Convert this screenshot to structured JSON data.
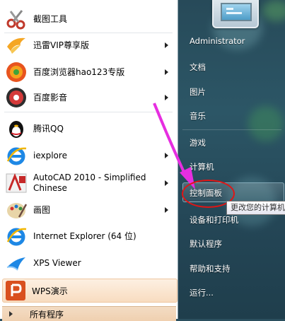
{
  "programs": [
    {
      "label": "截图工具",
      "icon": "scissors-icon",
      "has_submenu": false
    },
    {
      "label": "迅雷VIP尊享版",
      "icon": "thunder-bird-icon",
      "has_submenu": true
    },
    {
      "label": "百度浏览器hao123专版",
      "icon": "baidu-browser-icon",
      "has_submenu": true
    },
    {
      "label": "百度影音",
      "icon": "baidu-player-icon",
      "has_submenu": true
    },
    {
      "label": "腾讯QQ",
      "icon": "qq-penguin-icon",
      "has_submenu": false
    },
    {
      "label": "iexplore",
      "icon": "ie-icon",
      "has_submenu": true
    },
    {
      "label": "AutoCAD 2010 - Simplified Chinese",
      "label_line1": "AutoCAD 2010 - Simplified",
      "label_line2": "Chinese",
      "icon": "autocad-icon",
      "has_submenu": true
    },
    {
      "label": "画图",
      "icon": "paint-palette-icon",
      "has_submenu": true
    },
    {
      "label": "Internet Explorer (64 位)",
      "icon": "ie-icon",
      "has_submenu": false
    },
    {
      "label": "XPS Viewer",
      "icon": "xps-viewer-icon",
      "has_submenu": false
    }
  ],
  "pinned_highlight": {
    "label": "WPS演示",
    "icon": "wps-presentation-icon"
  },
  "all_programs": {
    "label": "所有程序"
  },
  "right": {
    "user": "Administrator",
    "documents": "文档",
    "pictures": "图片",
    "music": "音乐",
    "games": "游戏",
    "computer": "计算机",
    "control_panel": "控制面板",
    "devices": "设备和打印机",
    "default_programs": "默认程序",
    "help": "帮助和支持",
    "run": "运行..."
  },
  "tooltip": "更改您的计算机",
  "colors": {
    "annotation_arrow": "#e62ee0",
    "annotation_circle": "#e01515",
    "highlight_bg": "#fbe6d0"
  }
}
